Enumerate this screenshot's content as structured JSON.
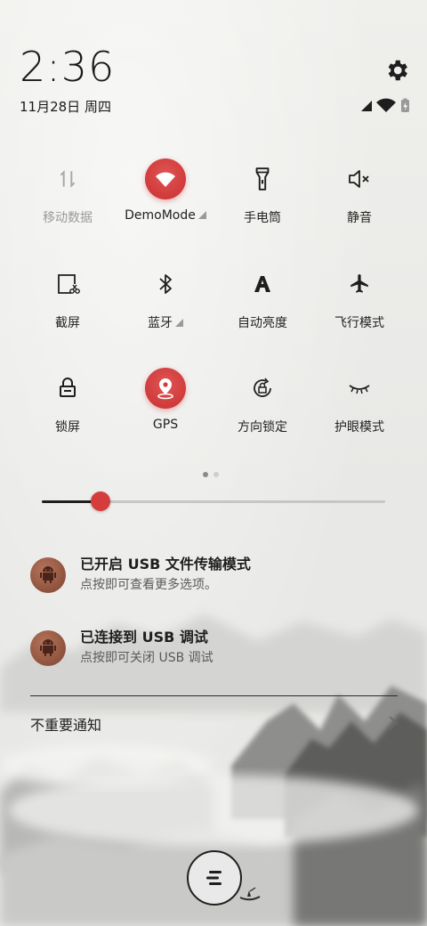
{
  "clock": {
    "time": "2:36",
    "date": "11月28日 周四"
  },
  "header_icons": [
    "gear-icon",
    "cellular-signal-icon",
    "wifi-icon",
    "battery-charging-icon"
  ],
  "tiles": [
    {
      "label": "移动数据",
      "icon": "mobile-data-icon",
      "active": false,
      "dim": true,
      "expand": false
    },
    {
      "label": "DemoMode",
      "icon": "wifi-icon",
      "active": true,
      "dim": false,
      "expand": true
    },
    {
      "label": "手电筒",
      "icon": "flashlight-icon",
      "active": false,
      "dim": false,
      "expand": false
    },
    {
      "label": "静音",
      "icon": "mute-icon",
      "active": false,
      "dim": false,
      "expand": false
    },
    {
      "label": "截屏",
      "icon": "screenshot-icon",
      "active": false,
      "dim": false,
      "expand": false
    },
    {
      "label": "蓝牙",
      "icon": "bluetooth-icon",
      "active": false,
      "dim": false,
      "expand": true
    },
    {
      "label": "自动亮度",
      "icon": "auto-brightness-icon",
      "active": false,
      "dim": false,
      "expand": false
    },
    {
      "label": "飞行模式",
      "icon": "airplane-icon",
      "active": false,
      "dim": false,
      "expand": false
    },
    {
      "label": "锁屏",
      "icon": "lock-icon",
      "active": false,
      "dim": false,
      "expand": false
    },
    {
      "label": "GPS",
      "icon": "location-icon",
      "active": true,
      "dim": false,
      "expand": false
    },
    {
      "label": "方向锁定",
      "icon": "rotation-lock-icon",
      "active": false,
      "dim": false,
      "expand": false
    },
    {
      "label": "护眼模式",
      "icon": "eye-care-icon",
      "active": false,
      "dim": false,
      "expand": false
    }
  ],
  "page_indicator": {
    "current": 1,
    "total": 2
  },
  "brightness": {
    "level": 0.17
  },
  "notifications": [
    {
      "title": "已开启 USB 文件传输模式",
      "subtitle": "点按即可查看更多选项。",
      "icon": "android-icon"
    },
    {
      "title": "已连接到 USB 调试",
      "subtitle": "点按即可关闭 USB 调试",
      "icon": "android-icon"
    }
  ],
  "unimportant": {
    "label": "不重要通知"
  },
  "colors": {
    "accent": "#d63c3c",
    "background": "#ececea",
    "text": "#1e1e1e"
  }
}
